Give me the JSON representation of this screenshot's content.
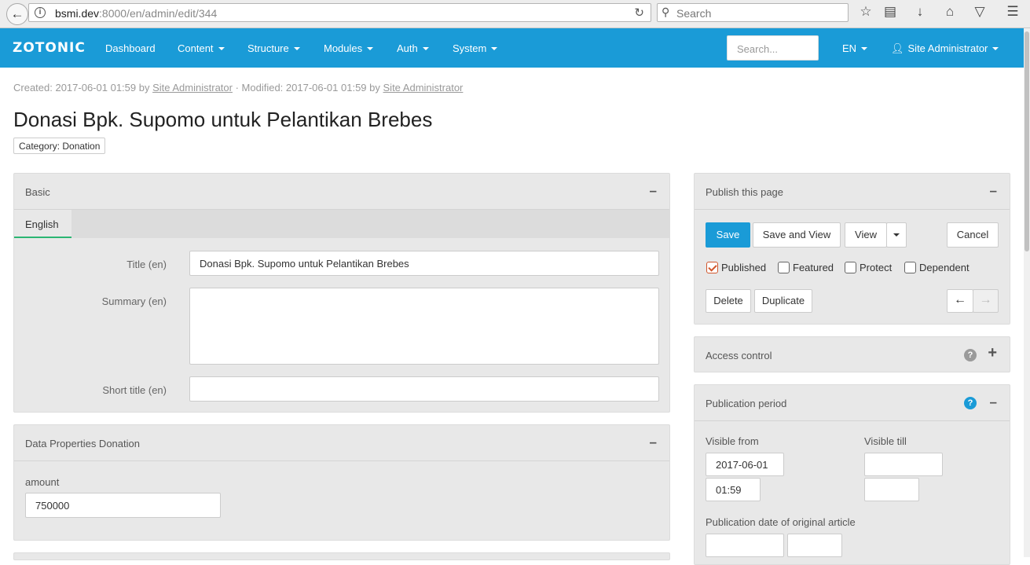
{
  "browser": {
    "url_host": "bsmi.dev",
    "url_rest": ":8000/en/admin/edit/344",
    "search_placeholder": "Search"
  },
  "navbar": {
    "logo": "ZOTONIC",
    "items": [
      {
        "label": "Dashboard",
        "dropdown": false
      },
      {
        "label": "Content",
        "dropdown": true
      },
      {
        "label": "Structure",
        "dropdown": true
      },
      {
        "label": "Modules",
        "dropdown": true
      },
      {
        "label": "Auth",
        "dropdown": true
      },
      {
        "label": "System",
        "dropdown": true
      }
    ],
    "search_placeholder": "Search...",
    "language": "EN",
    "user": "Site Administrator"
  },
  "page": {
    "created_label": "Created: 2017-06-01 01:59 by",
    "created_by": "Site Administrator",
    "modified_label": "· Modified: 2017-06-01 01:59 by",
    "modified_by": "Site Administrator",
    "title": "Donasi Bpk. Supomo untuk Pelantikan Brebes",
    "category": "Category: Donation"
  },
  "basic_panel": {
    "title": "Basic",
    "tab": "English",
    "fields": {
      "title_label": "Title (en)",
      "title_value": "Donasi Bpk. Supomo untuk Pelantikan Brebes",
      "summary_label": "Summary (en)",
      "summary_value": "",
      "short_title_label": "Short title (en)",
      "short_title_value": ""
    }
  },
  "data_panel": {
    "title": "Data Properties Donation",
    "amount_label": "amount",
    "amount_value": "750000"
  },
  "publish_panel": {
    "title": "Publish this page",
    "save": "Save",
    "save_and_view": "Save and View",
    "view": "View",
    "cancel": "Cancel",
    "checkboxes": [
      {
        "label": "Published",
        "checked": true
      },
      {
        "label": "Featured",
        "checked": false
      },
      {
        "label": "Protect",
        "checked": false
      },
      {
        "label": "Dependent",
        "checked": false
      }
    ],
    "delete": "Delete",
    "duplicate": "Duplicate"
  },
  "access_panel": {
    "title": "Access control"
  },
  "publication_panel": {
    "title": "Publication period",
    "visible_from_label": "Visible from",
    "visible_from_date": "2017-06-01",
    "visible_from_time": "01:59",
    "visible_till_label": "Visible till",
    "visible_till_date": "",
    "visible_till_time": "",
    "original_date_label": "Publication date of original article"
  },
  "colors": {
    "brand": "#1a9bd7",
    "tab_accent": "#2bb673",
    "checkbox_accent": "#d0562c"
  }
}
